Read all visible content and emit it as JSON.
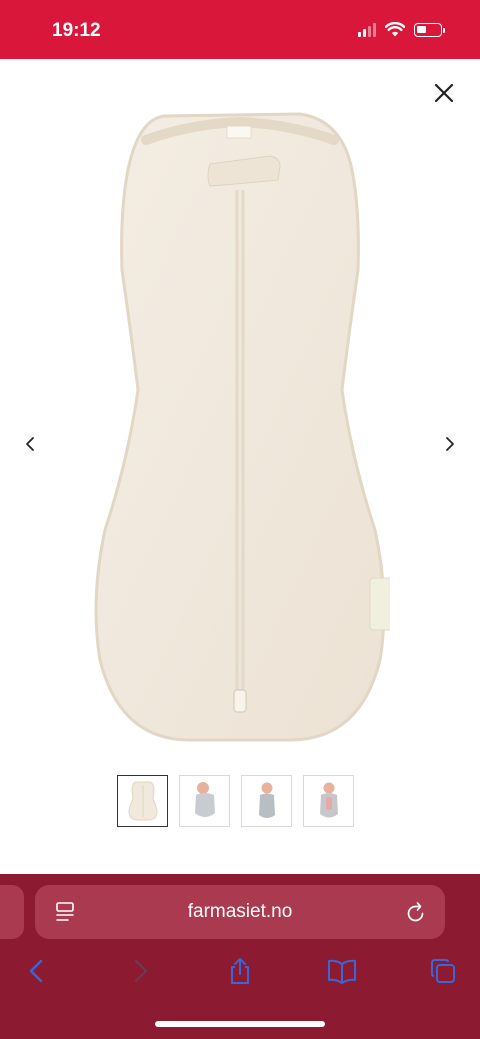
{
  "status_bar": {
    "time": "19:12",
    "background": "#d8173a",
    "icons": [
      "cellular-signal-icon",
      "wifi-icon",
      "battery-icon"
    ]
  },
  "viewer": {
    "close_icon": "close-icon",
    "prev_icon": "chevron-left-icon",
    "next_icon": "chevron-right-icon",
    "product_color": "#f1e9dd",
    "thumbnail_count": 4,
    "active_thumbnail": 1
  },
  "browser": {
    "url": "farmasiet.no",
    "background": "#8c1a30",
    "field_background": "#a93a4f",
    "icon_color": "#3a66d8",
    "toolbar": [
      "back-icon",
      "forward-icon",
      "share-icon",
      "bookmarks-icon",
      "tabs-icon"
    ]
  }
}
